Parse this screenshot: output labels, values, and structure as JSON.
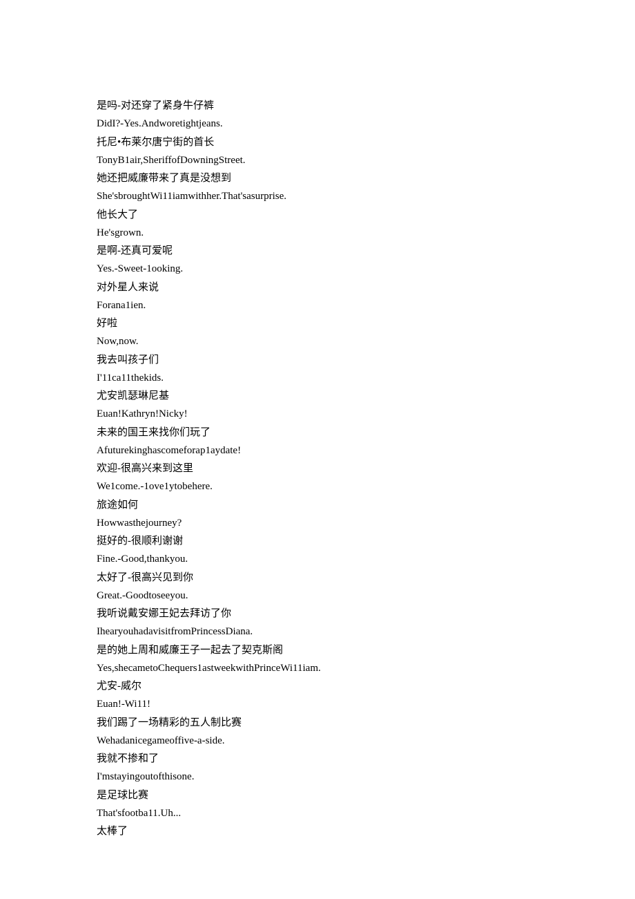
{
  "lines": [
    "是吗-对还穿了紧身牛仔裤",
    "DidI?-Yes.Andworetightjeans.",
    "托尼•布莱尔唐宁街的首长",
    "TonyB1air,SheriffofDowningStreet.",
    "她还把威廉带来了真是没想到",
    "She'sbroughtWi11iamwithher.That'sasurprise.",
    "他长大了",
    "He'sgrown.",
    "是啊-还真可爱呢",
    "Yes.-Sweet-1ooking.",
    "对外星人来说",
    "Forana1ien.",
    "好啦",
    "Now,now.",
    "我去叫孩子们",
    "I'11ca11thekids.",
    "尤安凯瑟琳尼基",
    "Euan!Kathryn!Nicky!",
    "未来的国王来找你们玩了",
    "Afuturekinghascomeforap1aydate!",
    "欢迎-很高兴来到这里",
    "We1come.-1ove1ytobehere.",
    "旅途如何",
    "Howwasthejourney?",
    "挺好的-很顺利谢谢",
    "Fine.-Good,thankyou.",
    "太好了-很高兴见到你",
    "Great.-Goodtoseeyou.",
    "我听说戴安娜王妃去拜访了你",
    "IhearyouhadavisitfromPrincessDiana.",
    "是的她上周和威廉王子一起去了契克斯阁",
    "Yes,shecametoChequers1astweekwithPrinceWi11iam.",
    "尤安-威尔",
    "Euan!-Wi11!",
    "我们踢了一场精彩的五人制比赛",
    "Wehadanicegameoffive-a-side.",
    "我就不掺和了",
    "I'mstayingoutofthisone.",
    "是足球比赛",
    "That'sfootba11.Uh...",
    "太棒了"
  ]
}
